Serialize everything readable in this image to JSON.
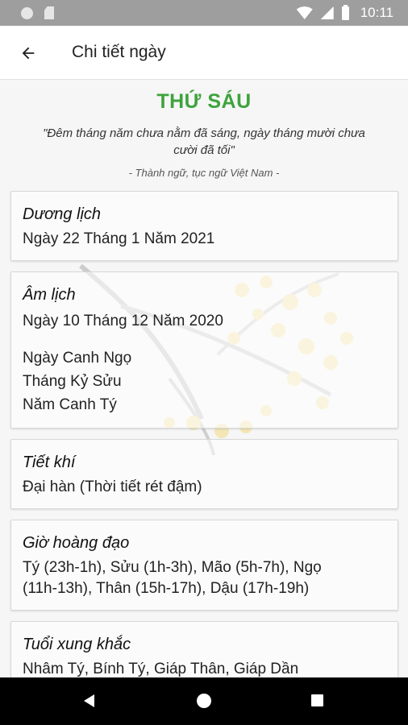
{
  "status_bar": {
    "time": "10:11",
    "icons": [
      "circle-icon",
      "sd-card-icon",
      "wifi-icon",
      "signal-icon",
      "battery-icon"
    ]
  },
  "app_bar": {
    "back_icon": "arrow-left-icon",
    "title": "Chi tiết ngày"
  },
  "day": {
    "name": "THỨ SÁU",
    "quote": "\"Đêm tháng năm chưa nằm đã sáng, ngày tháng mười chưa cười đã tối\"",
    "quote_source": "- Thành ngữ, tục ngữ Việt Nam -"
  },
  "cards": {
    "solar": {
      "title": "Dương lịch",
      "value": "Ngày 22 Tháng 1 Năm 2021"
    },
    "lunar": {
      "title": "Âm lịch",
      "value": "Ngày 10 Tháng 12 Năm 2020",
      "can_chi_day": "Ngày Canh Ngọ",
      "can_chi_month": "Tháng Kỷ Sửu",
      "can_chi_year": "Năm Canh Tý"
    },
    "solar_term": {
      "title": "Tiết khí",
      "value": "Đại hàn (Thời tiết rét đậm)"
    },
    "lucky_hours": {
      "title": "Giờ hoàng đạo",
      "line1": "Tý (23h-1h), Sửu (1h-3h), Mão (5h-7h), Ngọ",
      "line2": "(11h-13h), Thân (15h-17h), Dậu (17h-19h)"
    },
    "conflict_ages": {
      "title": "Tuổi xung khắc",
      "value": "Nhâm Tý, Bính Tý, Giáp Thân, Giáp Dần"
    }
  },
  "nav_bar": {
    "icons": [
      "nav-back-icon",
      "nav-home-icon",
      "nav-recents-icon"
    ]
  },
  "colors": {
    "accent": "#3ea33e",
    "status_bar": "#9e9e9e",
    "nav_bar": "#000000",
    "background": "#f6f6f6"
  }
}
